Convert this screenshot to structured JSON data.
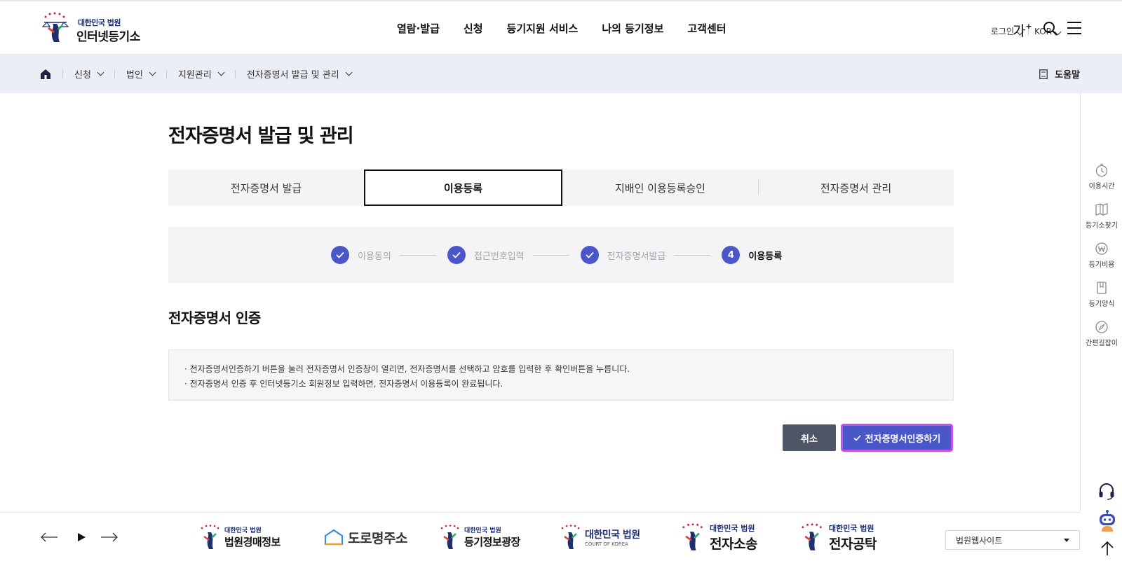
{
  "header": {
    "logo_sub": "대한민국 법원",
    "logo_main": "인터넷등기소",
    "nav": [
      "열람·발급",
      "신청",
      "등기지원 서비스",
      "나의 등기정보",
      "고객센터"
    ],
    "login": "로그인",
    "language": "KOR",
    "font_size": "가",
    "font_plus": "+"
  },
  "breadcrumb": {
    "items": [
      "신청",
      "법인",
      "지원관리",
      "전자증명서 발급 및 관리"
    ],
    "help": "도움말"
  },
  "quick_menu": [
    "이용시간",
    "등기소찾기",
    "등기비용",
    "등기양식",
    "간편길잡이"
  ],
  "main": {
    "title": "전자증명서 발급 및 관리",
    "tabs": [
      {
        "label": "전자증명서 발급",
        "active": false
      },
      {
        "label": "이용등록",
        "active": true
      },
      {
        "label": "지배인 이용등록승인",
        "active": false
      },
      {
        "label": "전자증명서 관리",
        "active": false
      }
    ],
    "steps": [
      {
        "label": "이용동의",
        "done": true
      },
      {
        "label": "접근번호입력",
        "done": true
      },
      {
        "label": "전자증명서발급",
        "done": true
      },
      {
        "number": "4",
        "label": "이용등록",
        "current": true
      }
    ],
    "section_title": "전자증명서 인증",
    "notices": [
      "· 전자증명서인증하기 버튼을 눌러 전자증명서 인증창이 열리면, 전자증명서를 선택하고 암호를 입력한 후 확인버튼을 누릅니다.",
      "· 전자증명서 인증 후 인터넷등기소 회원정보 입력하면, 전자증명서 이용등록이 완료됩니다."
    ],
    "cancel_label": "취소",
    "confirm_label": "전자증명서인증하기"
  },
  "footer": {
    "banners": [
      {
        "sub": "대한민국 법원",
        "main": "법원경매정보"
      },
      {
        "main": "도로명주소"
      },
      {
        "sub": "대한민국 법원",
        "main": "등기정보광장"
      },
      {
        "main": "대한민국 법원",
        "en": "COURT OF KOREA"
      },
      {
        "sub": "대한민국 법원",
        "main": "전자소송"
      },
      {
        "sub": "대한민국 법원",
        "main": "전자공탁"
      }
    ],
    "site_select": "법원웹사이트"
  },
  "colors": {
    "accent": "#4a57c9",
    "focus_ring": "#c452e8",
    "cancel_bg": "#4f5466",
    "breadcrumb_bg": "#eceef5"
  }
}
